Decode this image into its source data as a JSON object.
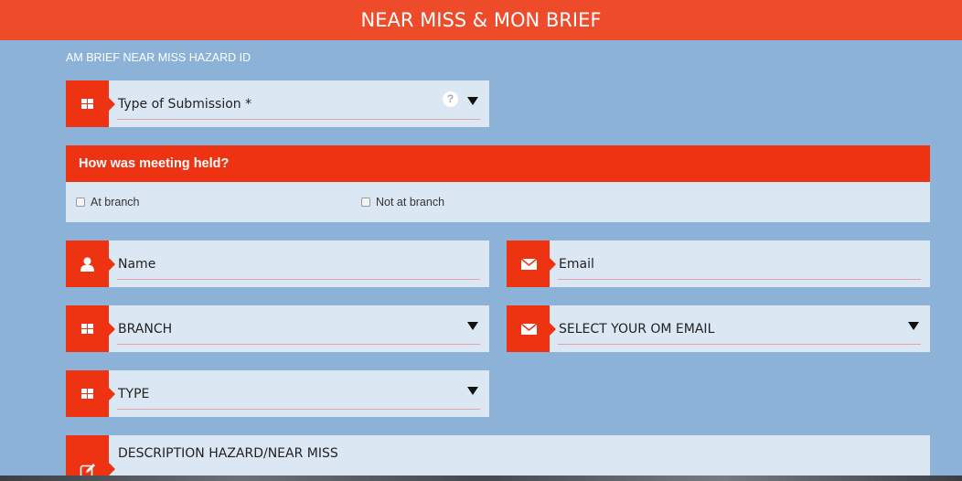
{
  "header": {
    "title": "NEAR MISS & MON BRIEF"
  },
  "form": {
    "subtitle": "AM BRIEF NEAR MISS HAZARD ID",
    "submission_type": {
      "label": "Type of Submission *",
      "help": "?"
    },
    "meeting": {
      "question": "How was meeting held?",
      "options": [
        "At branch",
        "Not at branch"
      ]
    },
    "name": {
      "label": "Name"
    },
    "email": {
      "label": "Email"
    },
    "branch": {
      "label": "BRANCH"
    },
    "om_email": {
      "label": "SELECT YOUR OM EMAIL"
    },
    "type": {
      "label": "TYPE"
    },
    "description": {
      "label": "DESCRIPTION  HAZARD/NEAR MISS"
    }
  },
  "colors": {
    "accent": "#ee3312",
    "header": "#ee4b2b",
    "background": "#8db2d8",
    "field": "#dce7f4"
  }
}
